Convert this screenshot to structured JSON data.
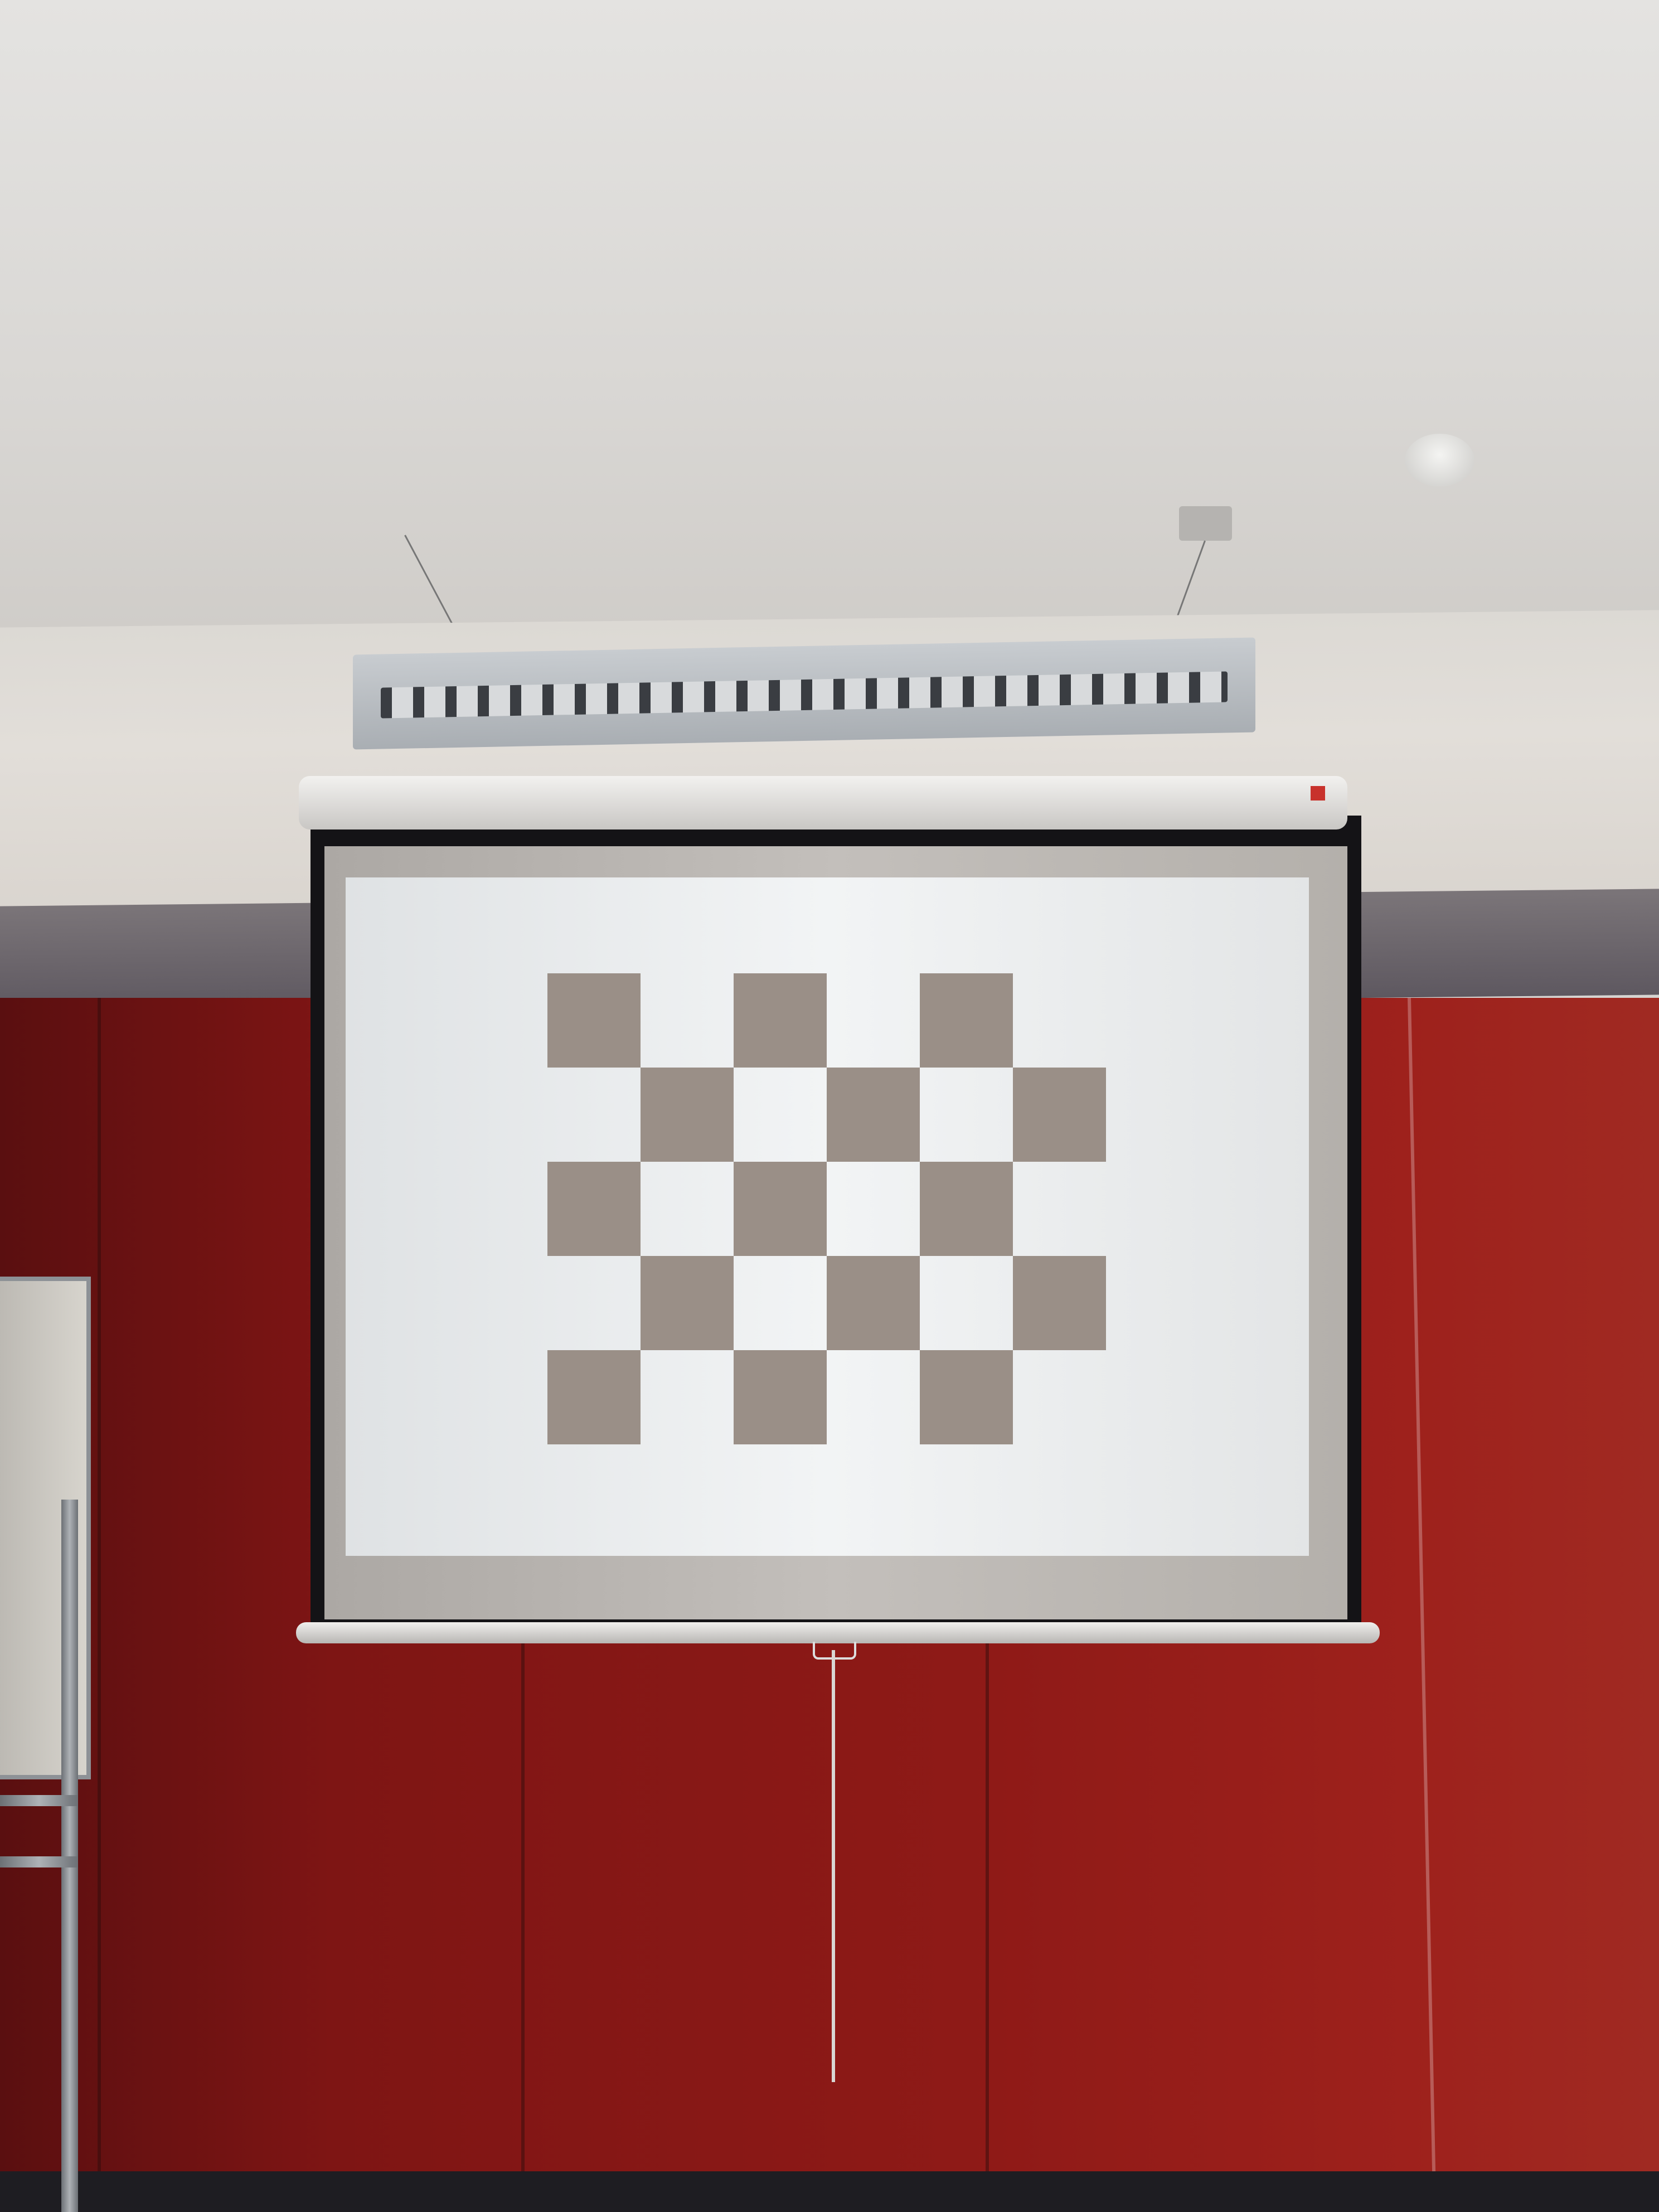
{
  "scene": {
    "description_type": "projector screen displaying a checkerboard in a room with red wall panels",
    "checkerboard": {
      "rows": 5,
      "cols": 6,
      "pattern": [
        [
          1,
          0,
          1,
          0,
          1,
          0
        ],
        [
          0,
          1,
          0,
          1,
          0,
          1
        ],
        [
          1,
          0,
          1,
          0,
          1,
          0
        ],
        [
          0,
          1,
          0,
          1,
          0,
          1
        ],
        [
          1,
          0,
          1,
          0,
          1,
          0
        ]
      ]
    },
    "colors": {
      "checker_dark": "#9a8f87",
      "projection_light": "#eef0f1",
      "screen_border": "#141316",
      "wall_red": "#8f1a17",
      "ceiling": "#dcdad7"
    }
  }
}
